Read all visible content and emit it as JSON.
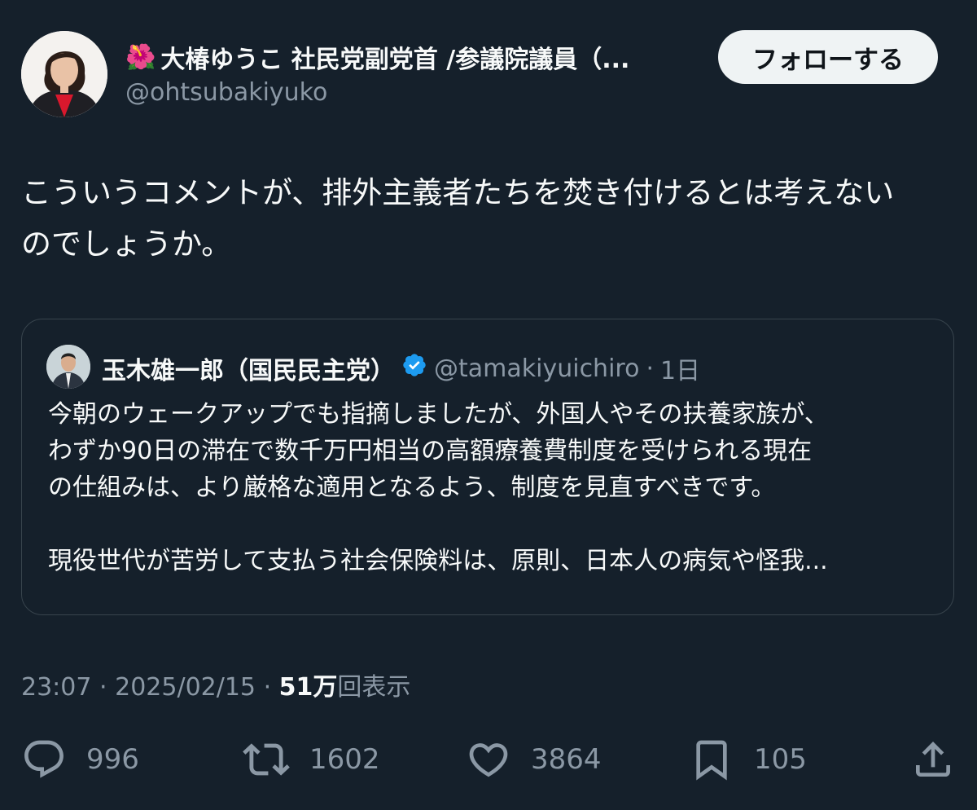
{
  "author": {
    "emoji": "🌺",
    "name": "大椿ゆうこ 社民党副党首 /参議院議員（...",
    "handle": "@ohtsubakiyuko"
  },
  "follow_label": "フォローする",
  "tweet": {
    "text": "こういうコメントが、排外主義者たちを焚き付けるとは考えない\nのでしょうか。"
  },
  "quote": {
    "name": "玉木雄一郎（国民民主党）",
    "handle": "@tamakiyuichiro",
    "separator": "·",
    "age": "1日",
    "text": "今朝のウェークアップでも指摘しましたが、外国人やその扶養家族が、\nわずか90日の滞在で数千万円相当の高額療養費制度を受けられる現在\nの仕組みは、より厳格な適用となるよう、制度を見直すべきです。\n\n現役世代が苦労して支払う社会保険料は、原則、日本人の病気や怪我..."
  },
  "meta": {
    "time": "23:07",
    "sep1": "·",
    "date": "2025/02/15",
    "sep2": "·",
    "views_count": "51万",
    "views_label": "回表示"
  },
  "actions": {
    "reply_count": "996",
    "retweet_count": "1602",
    "like_count": "3864",
    "bookmark_count": "105"
  },
  "colors": {
    "background": "#15202b",
    "verified": "#1d9bf0",
    "muted": "#8b98a5"
  },
  "icons": [
    "reply-icon",
    "retweet-icon",
    "like-icon",
    "bookmark-icon",
    "share-icon",
    "verified-badge-icon",
    "hibiscus-emoji"
  ]
}
